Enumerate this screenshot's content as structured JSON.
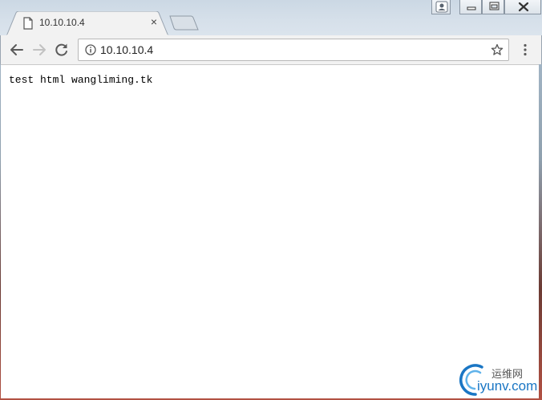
{
  "tab": {
    "title": "10.10.10.4",
    "close_glyph": "×",
    "favicon": "page-icon"
  },
  "toolbar": {
    "back": "back-arrow-icon",
    "forward": "forward-arrow-icon",
    "reload": "reload-icon",
    "menu": "kebab-menu-icon"
  },
  "omnibox": {
    "url": "10.10.10.4",
    "info_icon": "info-icon",
    "bookmark_icon": "star-icon"
  },
  "page": {
    "text": "test html wangliming.tk"
  },
  "watermark": {
    "cn": "运维网",
    "en": "iyunv.com"
  },
  "colors": {
    "tabstrip": "#d6e0ea",
    "toolbar": "#f2f2f2",
    "watermark_blue": "#1a76c4"
  }
}
